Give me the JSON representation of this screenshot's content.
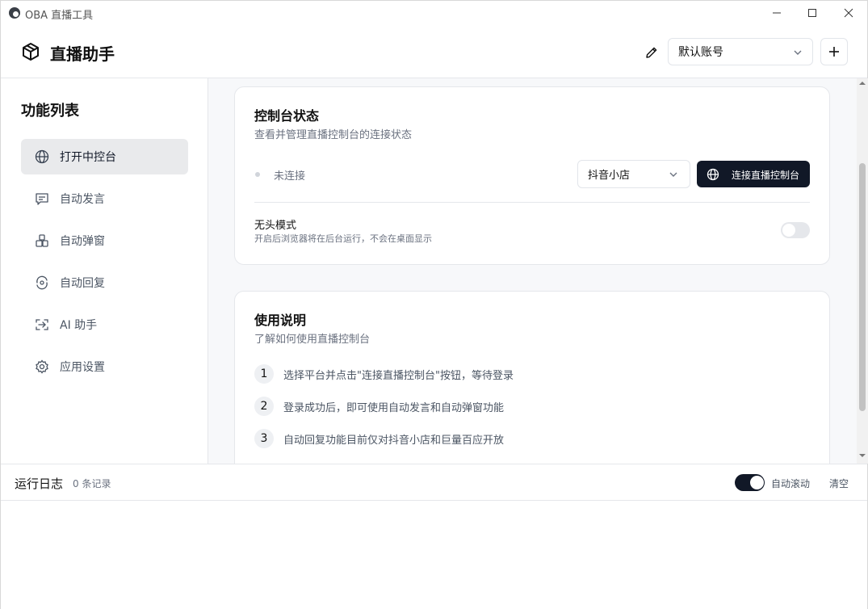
{
  "window": {
    "title": "OBA 直播工具",
    "controls": [
      "minimize-icon",
      "maximize-icon",
      "close-icon"
    ]
  },
  "header": {
    "brand": "直播助手",
    "account_select": {
      "value": "默认账号"
    }
  },
  "sidebar": {
    "title": "功能列表",
    "items": [
      {
        "label": "打开中控台",
        "icon": "globe-icon",
        "active": true
      },
      {
        "label": "自动发言",
        "icon": "message-icon",
        "active": false
      },
      {
        "label": "自动弹窗",
        "icon": "popup-icon",
        "active": false
      },
      {
        "label": "自动回复",
        "icon": "reply-icon",
        "active": false
      },
      {
        "label": "AI 助手",
        "icon": "ai-icon",
        "active": false
      },
      {
        "label": "应用设置",
        "icon": "gear-icon",
        "active": false
      }
    ]
  },
  "console_card": {
    "title": "控制台状态",
    "subtitle": "查看并管理直播控制台的连接状态",
    "status": "未连接",
    "platform_select": {
      "value": "抖音小店"
    },
    "connect_button": "连接直播控制台",
    "headless": {
      "title": "无头模式",
      "description": "开启后浏览器将在后台运行，不会在桌面显示",
      "enabled": false
    }
  },
  "usage_card": {
    "title": "使用说明",
    "subtitle": "了解如何使用直播控制台",
    "steps": [
      {
        "num": "1",
        "text": "选择平台并点击\"连接直播控制台\"按钮，等待登录"
      },
      {
        "num": "2",
        "text": "登录成功后，即可使用自动发言和自动弹窗功能"
      },
      {
        "num": "3",
        "text": "自动回复功能目前仅对抖音小店和巨量百应开放"
      }
    ]
  },
  "log": {
    "title": "运行日志",
    "count": "0 条记录",
    "autoscroll_label": "自动滚动",
    "autoscroll_enabled": true,
    "clear_label": "清空"
  },
  "colors": {
    "primary": "#111827",
    "active_nav_bg": "#e9eaec",
    "muted_text": "#6b7280",
    "main_bg": "#f7f8fa"
  }
}
